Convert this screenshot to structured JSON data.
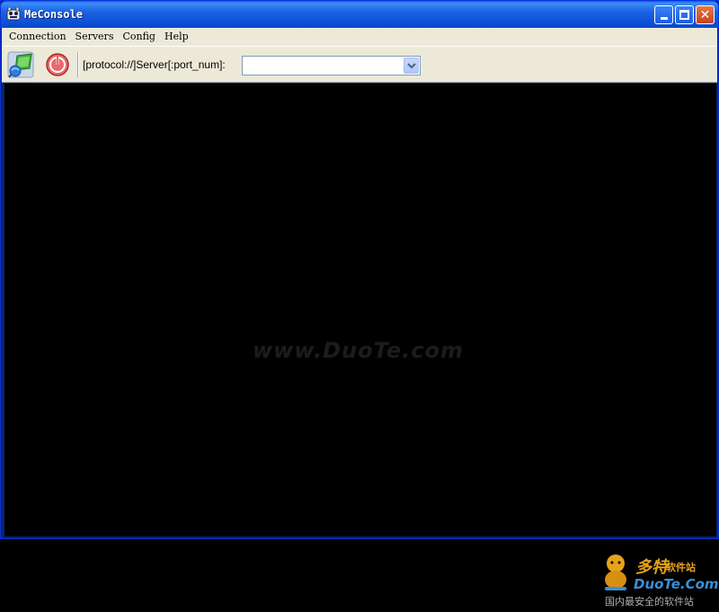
{
  "window": {
    "title": "MeConsole",
    "accent_color": "#0a5ce6"
  },
  "titlebar_buttons": {
    "minimize_icon": "minimize-icon",
    "maximize_icon": "maximize-icon",
    "close_glyph": "✕"
  },
  "menu": {
    "items": [
      {
        "label": "Connection"
      },
      {
        "label": "Servers"
      },
      {
        "label": "Config"
      },
      {
        "label": "Help"
      }
    ]
  },
  "toolbar": {
    "connect_icon": "network-connect-icon",
    "disconnect_icon": "power-icon",
    "server_label": "[protocol://]Server[:port_num]:",
    "server_value": "",
    "server_placeholder": ""
  },
  "console": {
    "background_color": "#000000",
    "watermark": "www.DuoTe.com"
  },
  "logo": {
    "cn_title": "多特",
    "cn_small": "软件站",
    "en": "DuoTe.Com",
    "sub": "国内最安全的软件站"
  }
}
